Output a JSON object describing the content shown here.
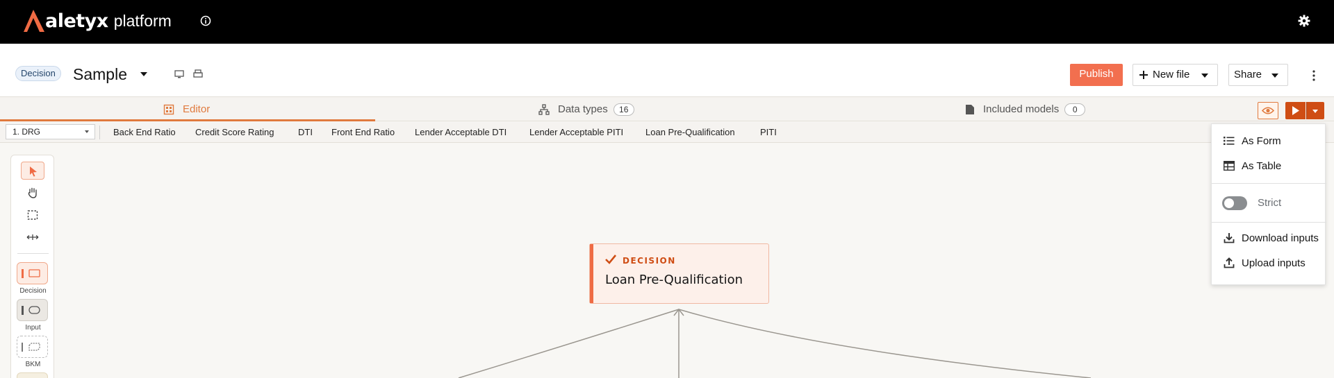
{
  "app": {
    "brand_word": "aletyx",
    "brand_suffix": "platform"
  },
  "header": {
    "badge": "Decision",
    "title": "Sample",
    "publish_label": "Publish",
    "new_file_label": "New file",
    "share_label": "Share"
  },
  "tabs": {
    "editor": "Editor",
    "data_types": "Data types",
    "data_types_count": "16",
    "included_models": "Included models",
    "included_models_count": "0"
  },
  "drg": {
    "selected": "1. DRG",
    "nodes": [
      "Back End Ratio",
      "Credit Score Rating",
      "DTI",
      "Front End Ratio",
      "Lender Acceptable DTI",
      "Lender Acceptable PITI",
      "Loan Pre-Qualification",
      "PITI"
    ]
  },
  "palette": {
    "decision_label": "Decision",
    "input_label": "Input",
    "bkm_label": "BKM"
  },
  "canvas_node": {
    "type": "DECISION",
    "name": "Loan Pre-Qualification"
  },
  "run_menu": {
    "as_form": "As Form",
    "as_table": "As Table",
    "strict_label": "Strict",
    "strict_on": false,
    "download_inputs": "Download inputs",
    "upload_inputs": "Upload inputs"
  },
  "colors": {
    "accent": "#e07a3e",
    "publish": "#f26f4f",
    "run": "#cf4d14",
    "topbar": "#000000"
  }
}
